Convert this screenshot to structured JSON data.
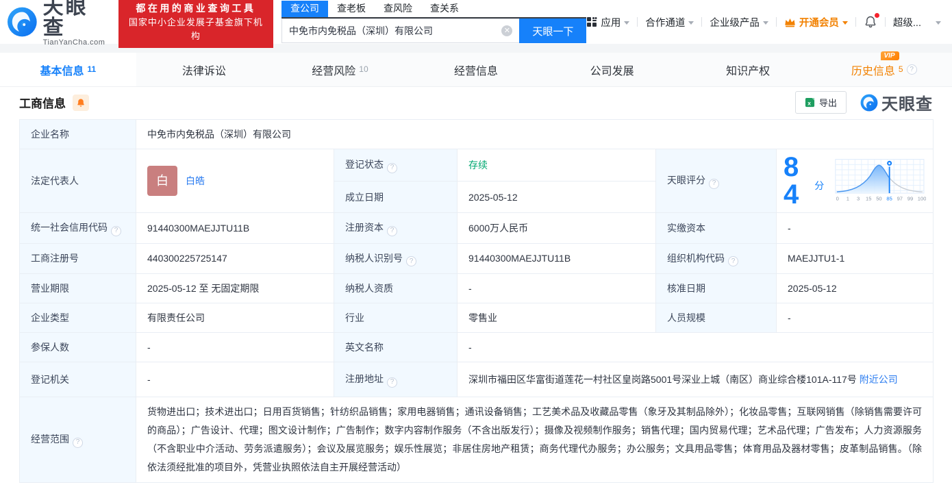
{
  "header": {
    "logo_title": "天眼查",
    "logo_domain": "TianYanCha.com",
    "banner_line1": "都在用的商业查询工具",
    "banner_line2": "国家中小企业发展子基金旗下机构",
    "search_tabs": [
      "查公司",
      "查老板",
      "查风险",
      "查关系"
    ],
    "search_value": "中免市内免税品（深圳）有限公司",
    "search_button_label": "天眼一下",
    "nav": {
      "apps": "应用",
      "partner": "合作通道",
      "enterprise": "企业级产品",
      "vip": "开通会员",
      "super": "超级..."
    }
  },
  "tabs": [
    {
      "label": "基本信息",
      "count": "11"
    },
    {
      "label": "法律诉讼",
      "count": ""
    },
    {
      "label": "经营风险",
      "count": "10"
    },
    {
      "label": "经营信息",
      "count": ""
    },
    {
      "label": "公司发展",
      "count": ""
    },
    {
      "label": "知识产权",
      "count": ""
    },
    {
      "label": "历史信息",
      "count": "5",
      "vip_badge": "VIP"
    }
  ],
  "section": {
    "title": "工商信息",
    "export_label": "导出",
    "watermark_text": "天眼查"
  },
  "fields": {
    "name_label": "企业名称",
    "name": "中免市内免税品（深圳）有限公司",
    "legal_rep_label": "法定代表人",
    "legal_rep_avatar": "白",
    "legal_rep": "白皓",
    "reg_status_label": "登记状态",
    "reg_status": "存续",
    "establish_date_label": "成立日期",
    "establish_date": "2025-05-12",
    "score_label": "天眼评分",
    "credit_code_label": "统一社会信用代码",
    "credit_code": "91440300MAEJJTU11B",
    "reg_capital_label": "注册资本",
    "reg_capital": "6000万人民币",
    "paid_capital_label": "实缴资本",
    "paid_capital": "-",
    "reg_number_label": "工商注册号",
    "reg_number": "440300225725147",
    "taxpayer_id_label": "纳税人识别号",
    "taxpayer_id": "91440300MAEJJTU11B",
    "org_code_label": "组织机构代码",
    "org_code": "MAEJJTU1-1",
    "business_term_label": "营业期限",
    "business_term": "2025-05-12 至 无固定期限",
    "taxpayer_quality_label": "纳税人资质",
    "taxpayer_quality": "-",
    "approve_date_label": "核准日期",
    "approve_date": "2025-05-12",
    "company_type_label": "企业类型",
    "company_type": "有限责任公司",
    "industry_label": "行业",
    "industry": "零售业",
    "staff_size_label": "人员规模",
    "staff_size": "-",
    "insured_label": "参保人数",
    "insured": "-",
    "english_name_label": "英文名称",
    "english_name": "-",
    "reg_authority_label": "登记机关",
    "reg_authority": "-",
    "address_label": "注册地址",
    "address": "深圳市福田区华富街道莲花一村社区皇岗路5001号深业上城（南区）商业综合楼101A-117号",
    "nearby_link": "附近公司",
    "business_scope_label": "经营范围",
    "business_scope": "货物进出口；技术进出口；日用百货销售；针纺织品销售；家用电器销售；通讯设备销售；工艺美术品及收藏品零售（象牙及其制品除外）；化妆品零售；互联网销售（除销售需要许可的商品）；广告设计、代理；图文设计制作；广告制作；数字内容制作服务（不含出版发行）；摄像及视频制作服务；销售代理；国内贸易代理；艺术品代理；广告发布；人力资源服务（不含职业中介活动、劳务派遣服务）；会议及展览服务；娱乐性展览；非居住房地产租赁；商务代理代办服务；办公服务；文具用品零售；体育用品及器材零售；皮革制品销售。（除依法须经批准的项目外，凭营业执照依法自主开展经营活动）"
  },
  "score_chart": {
    "score": "84",
    "unit": "分",
    "axis_labels": [
      "0",
      "1",
      "3",
      "15",
      "50",
      "85",
      "97",
      "99",
      "100"
    ],
    "marker_value": 84
  },
  "colors": {
    "primary_blue": "#1681fa",
    "banner_red": "#d9252a",
    "vip_orange": "#f28100",
    "status_green": "#00a870",
    "label_bg": "#f2f9ff",
    "link_blue": "#2b7cf0"
  }
}
